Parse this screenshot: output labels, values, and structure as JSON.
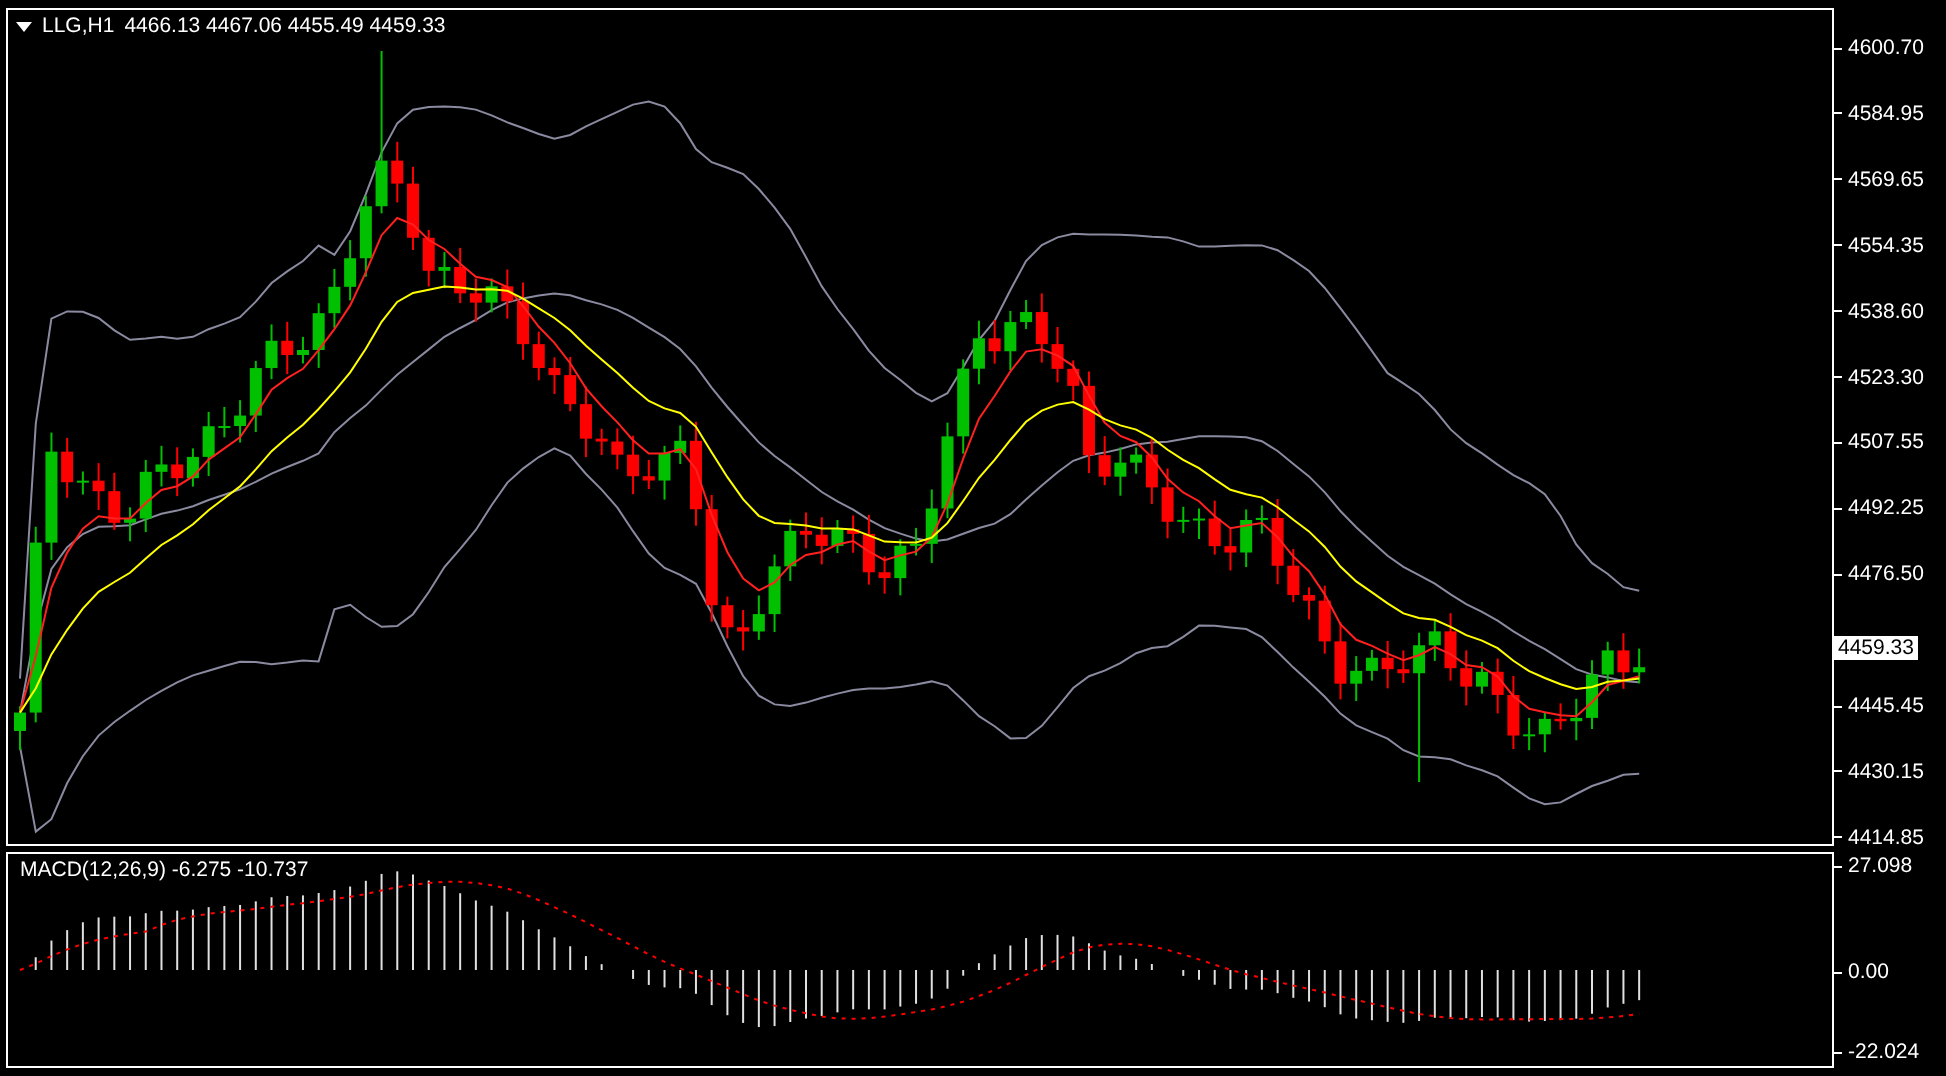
{
  "header": {
    "symbol": "LLG,H1",
    "ohlc": "4466.13 4467.06 4455.49 4459.33"
  },
  "price_axis": {
    "labels": [
      "4600.70",
      "4584.95",
      "4569.65",
      "4554.35",
      "4538.60",
      "4523.30",
      "4507.55",
      "4492.25",
      "4476.50",
      "4445.45",
      "4430.15",
      "4414.85"
    ]
  },
  "current_price": "4459.33",
  "macd": {
    "label": "MACD(12,26,9) -6.275 -10.737",
    "axis_labels": [
      "27.098",
      "0.00",
      "-22.024"
    ]
  }
}
